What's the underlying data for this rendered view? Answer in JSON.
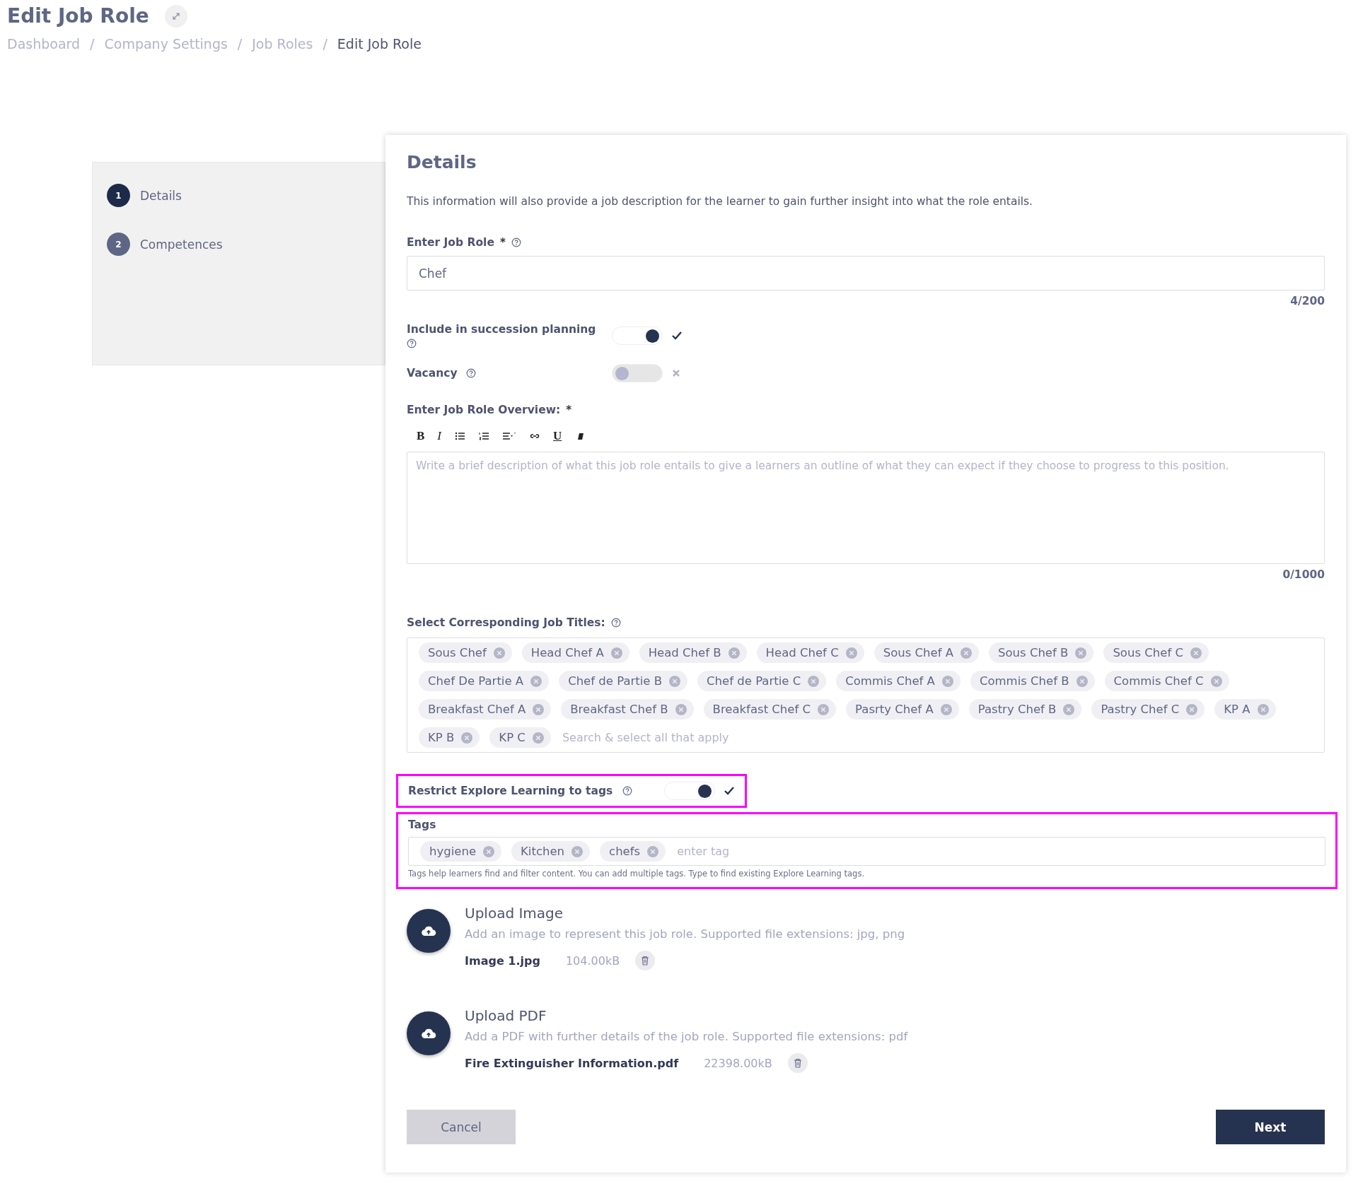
{
  "page": {
    "title": "Edit Job Role"
  },
  "breadcrumbs": [
    {
      "label": "Dashboard",
      "current": false
    },
    {
      "separator": "/",
      "label": "Company Settings",
      "current": false
    },
    {
      "separator": "/",
      "label": "Job Roles",
      "current": false
    },
    {
      "separator": "/",
      "label": "Edit Job Role",
      "current": true
    }
  ],
  "steps": [
    {
      "number": "1",
      "label": "Details",
      "selected": true
    },
    {
      "number": "2",
      "label": "Competences",
      "selected": false
    }
  ],
  "details": {
    "heading": "Details",
    "description": "This information will also provide a job description for the learner to gain further insight into what the role entails.",
    "job_role": {
      "label": "Enter Job Role",
      "required_mark": "*",
      "value": "Chef",
      "counter": "4/200"
    },
    "toggles": [
      {
        "label": "Include in succession planning",
        "on": true
      },
      {
        "label": "Vacancy",
        "on": false
      }
    ],
    "overview": {
      "label": "Enter Job Role Overview:",
      "required_mark": "*",
      "placeholder": "Write a brief description of what this job role entails to give a learners an outline of what they can expect if they choose to progress to this position.",
      "counter": "0/1000",
      "toolbar": [
        {
          "kind": "bold",
          "label": "B"
        },
        {
          "kind": "italic",
          "label": "I"
        },
        {
          "kind": "bullets"
        },
        {
          "kind": "numbers"
        },
        {
          "kind": "align"
        },
        {
          "kind": "link"
        },
        {
          "kind": "underline",
          "label": "U"
        },
        {
          "kind": "eraser"
        }
      ]
    },
    "job_titles": {
      "label": "Select Corresponding Job Titles:",
      "placeholder": "Search & select all that apply",
      "chips": [
        "Sous Chef",
        "Head Chef A",
        "Head Chef B",
        "Head Chef C",
        "Sous Chef A",
        "Sous Chef B",
        "Sous Chef C",
        "Chef De Partie A",
        "Chef de Partie B",
        "Chef de Partie C",
        "Commis Chef A",
        "Commis Chef B",
        "Commis Chef C",
        "Breakfast Chef A",
        "Breakfast Chef B",
        "Breakfast Chef C",
        "Pasrty Chef A",
        "Pastry Chef B",
        "Pastry Chef C",
        "KP A",
        "KP B",
        "KP C"
      ]
    },
    "restrict": {
      "label": "Restrict Explore Learning to tags",
      "on": true,
      "highlighted": true
    },
    "tags": {
      "label": "Tags",
      "chips": [
        "hygiene",
        "Kitchen",
        "chefs"
      ],
      "placeholder": "enter tag",
      "hint": "Tags help learners find and filter content. You can add multiple tags. Type to find existing Explore Learning tags.",
      "highlighted": true
    },
    "uploads": [
      {
        "title": "Upload Image",
        "description": "Add an image to represent this job role. Supported file extensions: jpg, png",
        "file_name": "Image 1.jpg",
        "file_size": "104.00kB"
      },
      {
        "title": "Upload PDF",
        "description": "Add a PDF with further details of the job role. Supported file extensions: pdf",
        "file_name": "Fire Extinguisher Information.pdf",
        "file_size": "22398.00kB"
      }
    ],
    "buttons": {
      "cancel": "Cancel",
      "next": "Next"
    }
  }
}
